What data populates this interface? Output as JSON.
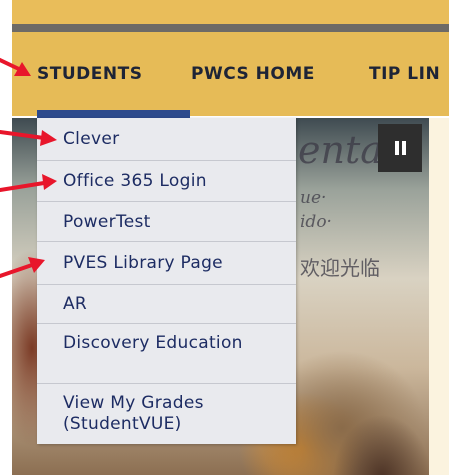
{
  "nav": {
    "items": [
      {
        "label": "STUDENTS",
        "active": true
      },
      {
        "label": "PWCS HOME"
      },
      {
        "label": "TIP LIN"
      }
    ]
  },
  "hero": {
    "mural_lines": [
      "enta",
      "ue·",
      "ido·",
      "欢迎光临"
    ],
    "pause_icon": "pause-icon"
  },
  "students_menu": {
    "items": [
      {
        "label": "Clever"
      },
      {
        "label": "Office 365 Login"
      },
      {
        "label": "PowerTest"
      },
      {
        "label": "PVES Library Page"
      },
      {
        "label": "AR"
      },
      {
        "label": "Discovery Education"
      },
      {
        "label": "View My Grades (StudentVUE)"
      }
    ]
  },
  "annotations": {
    "arrow_color": "#e8162b",
    "arrows": [
      "students",
      "clever",
      "office-365-login",
      "pves-library-page"
    ]
  },
  "colors": {
    "nav_background": "#e6bb57",
    "nav_text": "#1e2436",
    "active_underline": "#2d4a8c",
    "menu_background": "#e9eaee",
    "menu_text": "#1d2c63"
  }
}
